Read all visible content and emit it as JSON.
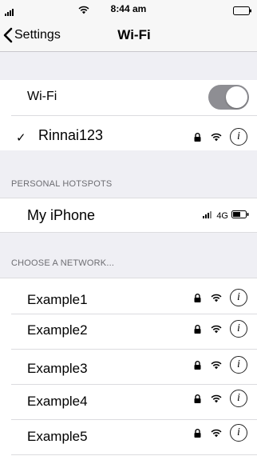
{
  "status_bar": {
    "time": "8:44 am"
  },
  "nav": {
    "back_label": "Settings",
    "title": "Wi-Fi"
  },
  "wifi_toggle": {
    "label": "Wi-Fi",
    "enabled": true
  },
  "connected_network": {
    "name": "Rinnai123",
    "secured": true
  },
  "hotspots": {
    "header": "PERSONAL HOTSPOTS",
    "items": [
      {
        "name": "My iPhone",
        "network_type": "4G"
      }
    ]
  },
  "networks": {
    "header": "CHOOSE A NETWORK...",
    "items": [
      {
        "name": "Example1",
        "secured": true
      },
      {
        "name": "Example2",
        "secured": true
      },
      {
        "name": "Example3",
        "secured": true
      },
      {
        "name": "Example4",
        "secured": true
      },
      {
        "name": "Example5",
        "secured": true
      }
    ]
  },
  "icons": {
    "info": "i"
  }
}
